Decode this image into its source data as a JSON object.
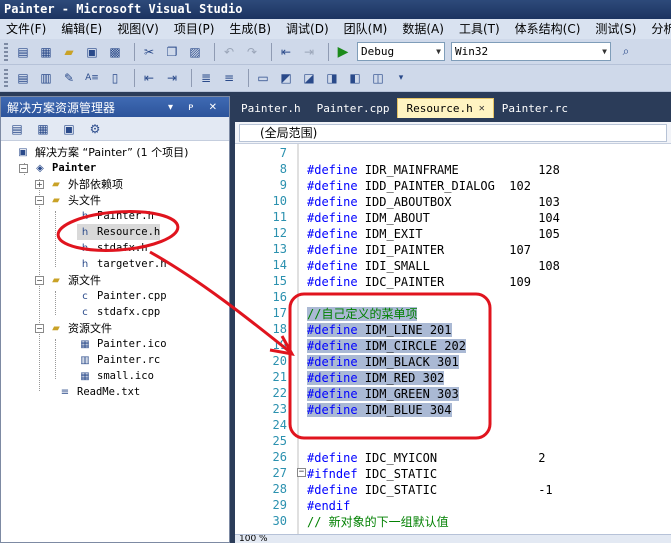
{
  "window": {
    "title": "Painter - Microsoft Visual Studio"
  },
  "menu": [
    "文件(F)",
    "编辑(E)",
    "视图(V)",
    "项目(P)",
    "生成(B)",
    "调试(D)",
    "团队(M)",
    "数据(A)",
    "工具(T)",
    "体系结构(C)",
    "测试(S)",
    "分析"
  ],
  "toolbar": {
    "config": "Debug",
    "platform": "Win32"
  },
  "solution_explorer": {
    "title": "解决方案资源管理器",
    "header_icons": "▾ ᴘ ✕",
    "tree": {
      "solution": "解决方案 “Painter” (1 个项目)",
      "project": "Painter",
      "external_deps": "外部依赖项",
      "headers_folder": "头文件",
      "headers": [
        "Painter.h",
        "Resource.h",
        "stdafx.h",
        "targetver.h"
      ],
      "sources_folder": "源文件",
      "sources": [
        "Painter.cpp",
        "stdafx.cpp"
      ],
      "resources_folder": "资源文件",
      "resources": [
        "Painter.ico",
        "Painter.rc",
        "small.ico"
      ],
      "readme": "ReadMe.txt"
    }
  },
  "editor": {
    "tabs": [
      "Painter.h",
      "Painter.cpp",
      "Resource.h",
      "Painter.rc"
    ],
    "active_tab": "Resource.h",
    "scope": "(全局范围)",
    "zoom": "100 %",
    "lines": [
      {
        "n": "7",
        "text": ""
      },
      {
        "n": "8",
        "text": "#define IDR_MAINFRAME           128"
      },
      {
        "n": "9",
        "text": "#define IDD_PAINTER_DIALOG  102"
      },
      {
        "n": "10",
        "text": "#define IDD_ABOUTBOX            103"
      },
      {
        "n": "11",
        "text": "#define IDM_ABOUT               104"
      },
      {
        "n": "12",
        "text": "#define IDM_EXIT                105"
      },
      {
        "n": "13",
        "text": "#define IDI_PAINTER         107"
      },
      {
        "n": "14",
        "text": "#define IDI_SMALL               108"
      },
      {
        "n": "15",
        "text": "#define IDC_PAINTER         109"
      },
      {
        "n": "16",
        "text": ""
      },
      {
        "n": "17",
        "text": "//自己定义的菜单项"
      },
      {
        "n": "18",
        "text": "#define IDM_LINE 201"
      },
      {
        "n": "19",
        "text": "#define IDM_CIRCLE 202"
      },
      {
        "n": "20",
        "text": "#define IDM_BLACK 301"
      },
      {
        "n": "21",
        "text": "#define IDM_RED 302"
      },
      {
        "n": "22",
        "text": "#define IDM_GREEN 303"
      },
      {
        "n": "23",
        "text": "#define IDM_BLUE 304"
      },
      {
        "n": "24",
        "text": ""
      },
      {
        "n": "25",
        "text": ""
      },
      {
        "n": "26",
        "text": "#define IDC_MYICON              2"
      },
      {
        "n": "27",
        "text": "#ifndef IDC_STATIC"
      },
      {
        "n": "28",
        "text": "#define IDC_STATIC              -1"
      },
      {
        "n": "29",
        "text": "#endif"
      },
      {
        "n": "30",
        "text": "// 新对象的下一组默认值"
      }
    ]
  },
  "colors": {
    "annotation": "#e0141e",
    "keyword": "#0000ff",
    "comment": "#008000",
    "line_number": "#2b91af"
  }
}
